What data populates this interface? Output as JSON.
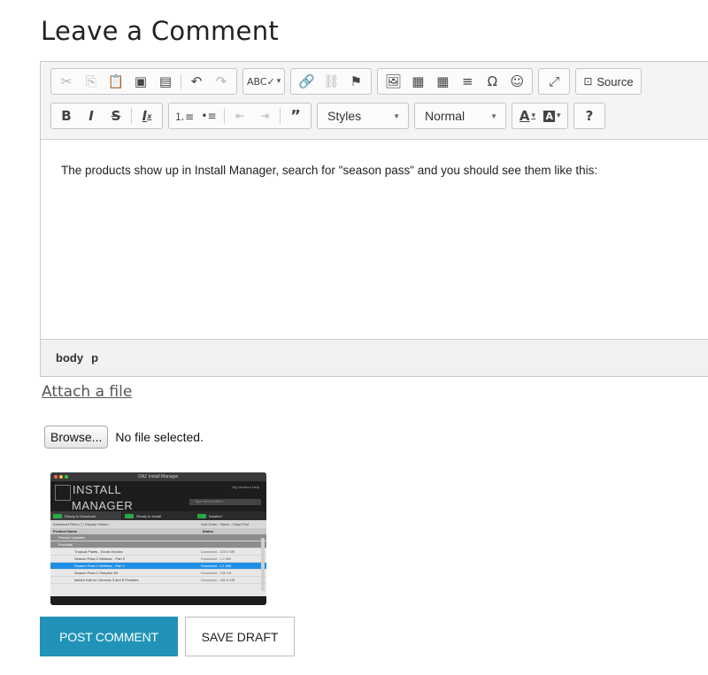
{
  "heading": "Leave a Comment",
  "editor": {
    "toolbar": {
      "source_label": "Source",
      "styles_label": "Styles",
      "format_label": "Normal",
      "help_label": "?"
    },
    "content": "The products show up in Install Manager, search for \"season pass\" and you should see them like this:",
    "path": [
      "body",
      "p"
    ]
  },
  "attach_link": "Attach a file",
  "file_input": {
    "browse_label": "Browse...",
    "status": "No file selected."
  },
  "thumbnail": {
    "window_title": "DAZ Install Manager",
    "logo_line1": "INSTALL",
    "logo_line2": "MANAGER",
    "nav_text": "My Vendors  Help",
    "search_placeholder": "Type here to filter...",
    "tabs": [
      "Ready to Download",
      "Ready to Install",
      "Installed"
    ],
    "filters_label": "Download Filters",
    "display_hidden": "Display Hidden",
    "sort_order": "Sort Order : Name - Easy First",
    "col_product": "Product Name",
    "col_status": "Status",
    "rows": [
      {
        "name": "Product Updates",
        "status": "",
        "type": "group"
      },
      {
        "name": "Products",
        "status": "",
        "type": "group"
      },
      {
        "name": "Tropical Plants - Exotic Exotics",
        "status": "Download - 325.5 MB",
        "type": "normal"
      },
      {
        "name": "Season Pass 2 Webinar - Part 2",
        "status": "Download - 1.2 MB",
        "type": "normal"
      },
      {
        "name": "Season Pass 2 Webinar - Part 1",
        "status": "Download - 1.1 MB",
        "type": "selected"
      },
      {
        "name": "Season Pass 2 Gimplive Kit",
        "status": "Download - 156 KB",
        "type": "normal"
      },
      {
        "name": "lashful Hair for Genesis 3 and 8 Females",
        "status": "Download - 351.6 MB",
        "type": "normal"
      }
    ]
  },
  "buttons": {
    "post": "POST COMMENT",
    "draft": "SAVE DRAFT"
  },
  "colors": {
    "post_button": "#2193b8",
    "selected_row": "#1f8fe6",
    "tab_badge": "#2aa84a"
  }
}
